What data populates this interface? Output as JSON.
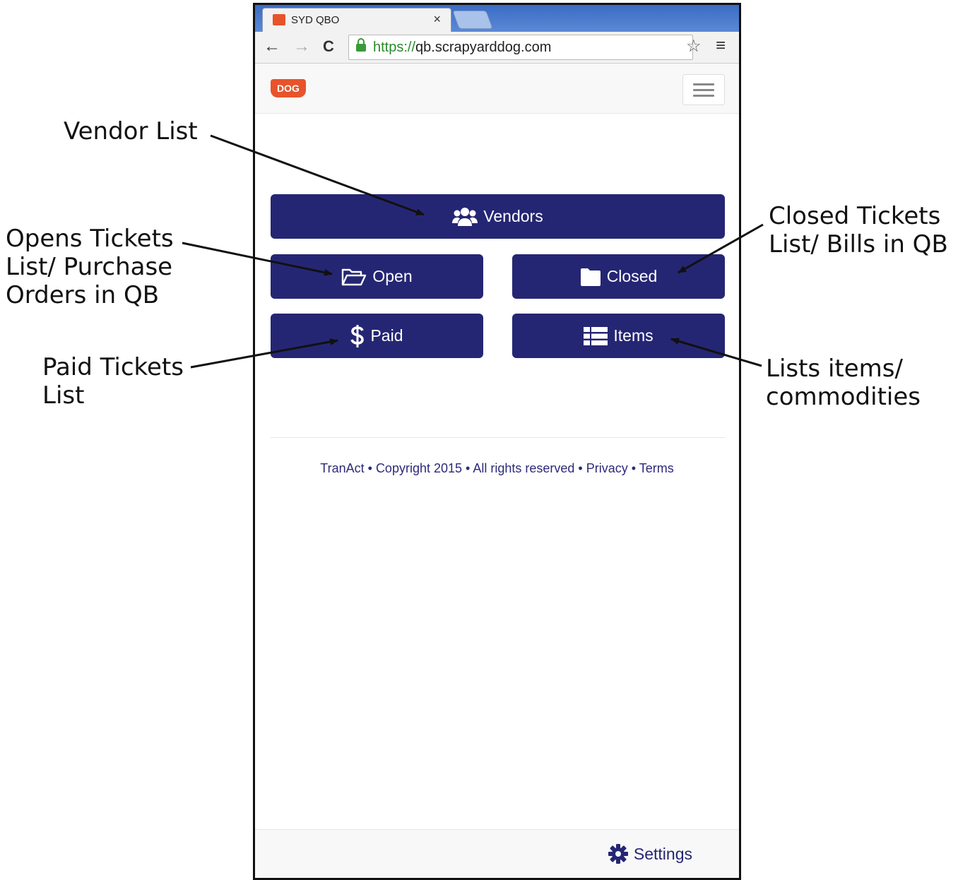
{
  "browser": {
    "tab_title": "SYD QBO",
    "tab_close": "×",
    "url_scheme": "https://",
    "url_host": "qb.scrapyarddog.com",
    "back": "←",
    "forward": "→",
    "reload": "C",
    "bookmark": "☆",
    "menu": "≡"
  },
  "app": {
    "logo_text": "DOG",
    "buttons": {
      "vendors": "Vendors",
      "open": "Open",
      "closed": "Closed",
      "paid": "Paid",
      "items": "Items"
    },
    "footer": {
      "brand": "TranAct",
      "copyright": "Copyright 2015",
      "rights": "All rights reserved",
      "privacy": "Privacy",
      "terms": "Terms",
      "separator": " • "
    },
    "settings": "Settings",
    "accent_color": "#252673",
    "brand_color": "#e8532a"
  },
  "annotations": {
    "vendor_list": "Vendor List",
    "open_tickets": "Opens Tickets\nList/ Purchase\nOrders in QB",
    "closed_tickets": "Closed Tickets\nList/ Bills in QB",
    "paid_tickets": "Paid Tickets\nList",
    "items": "Lists items/\ncommodities"
  }
}
